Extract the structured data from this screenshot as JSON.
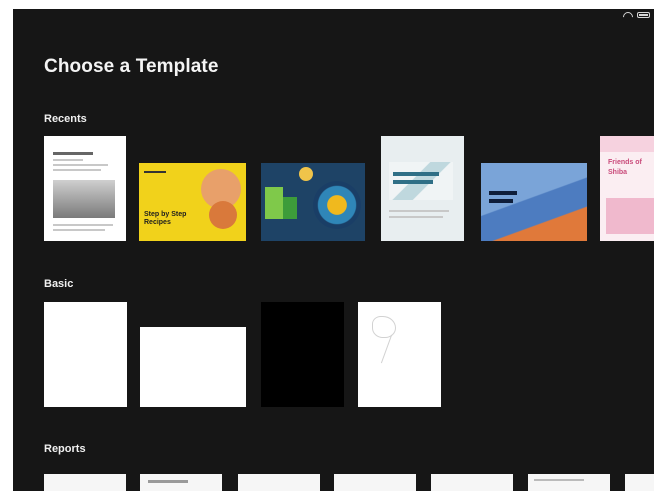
{
  "status_bar": {
    "time": "",
    "battery_percent": ""
  },
  "nav": {
    "cancel_label": ""
  },
  "page_title": "Choose a Template",
  "categories": [
    {
      "label": "",
      "active": true
    },
    {
      "label": "",
      "active": false
    },
    {
      "label": "",
      "active": false
    },
    {
      "label": "",
      "active": false
    },
    {
      "label": "",
      "active": false
    },
    {
      "label": "",
      "active": false
    },
    {
      "label": "",
      "active": false
    },
    {
      "label": "",
      "active": false
    },
    {
      "label": "",
      "active": false
    },
    {
      "label": "",
      "active": false
    },
    {
      "label": "",
      "active": false
    }
  ],
  "sections": {
    "recents": {
      "title": "Recents",
      "see_all_label": "",
      "items": [
        {
          "label": "",
          "thumb_title": ""
        },
        {
          "label": "",
          "thumb_title": "Step by Step Recipes"
        },
        {
          "label": "",
          "thumb_title": ""
        },
        {
          "label": "",
          "thumb_title": ""
        },
        {
          "label": "",
          "thumb_title": ""
        },
        {
          "label": "",
          "thumb_title": "Friends of Shiba"
        }
      ]
    },
    "basic": {
      "title": "Basic",
      "items": [
        {
          "label": ""
        },
        {
          "label": ""
        },
        {
          "label": ""
        },
        {
          "label": ""
        }
      ]
    },
    "reports": {
      "title": "Reports",
      "see_all_label": ""
    }
  },
  "colors": {
    "background": "#161616",
    "accent": "#c25d22",
    "poster_yellow": "#f1d21b",
    "poster_blue": "#1e4366"
  }
}
